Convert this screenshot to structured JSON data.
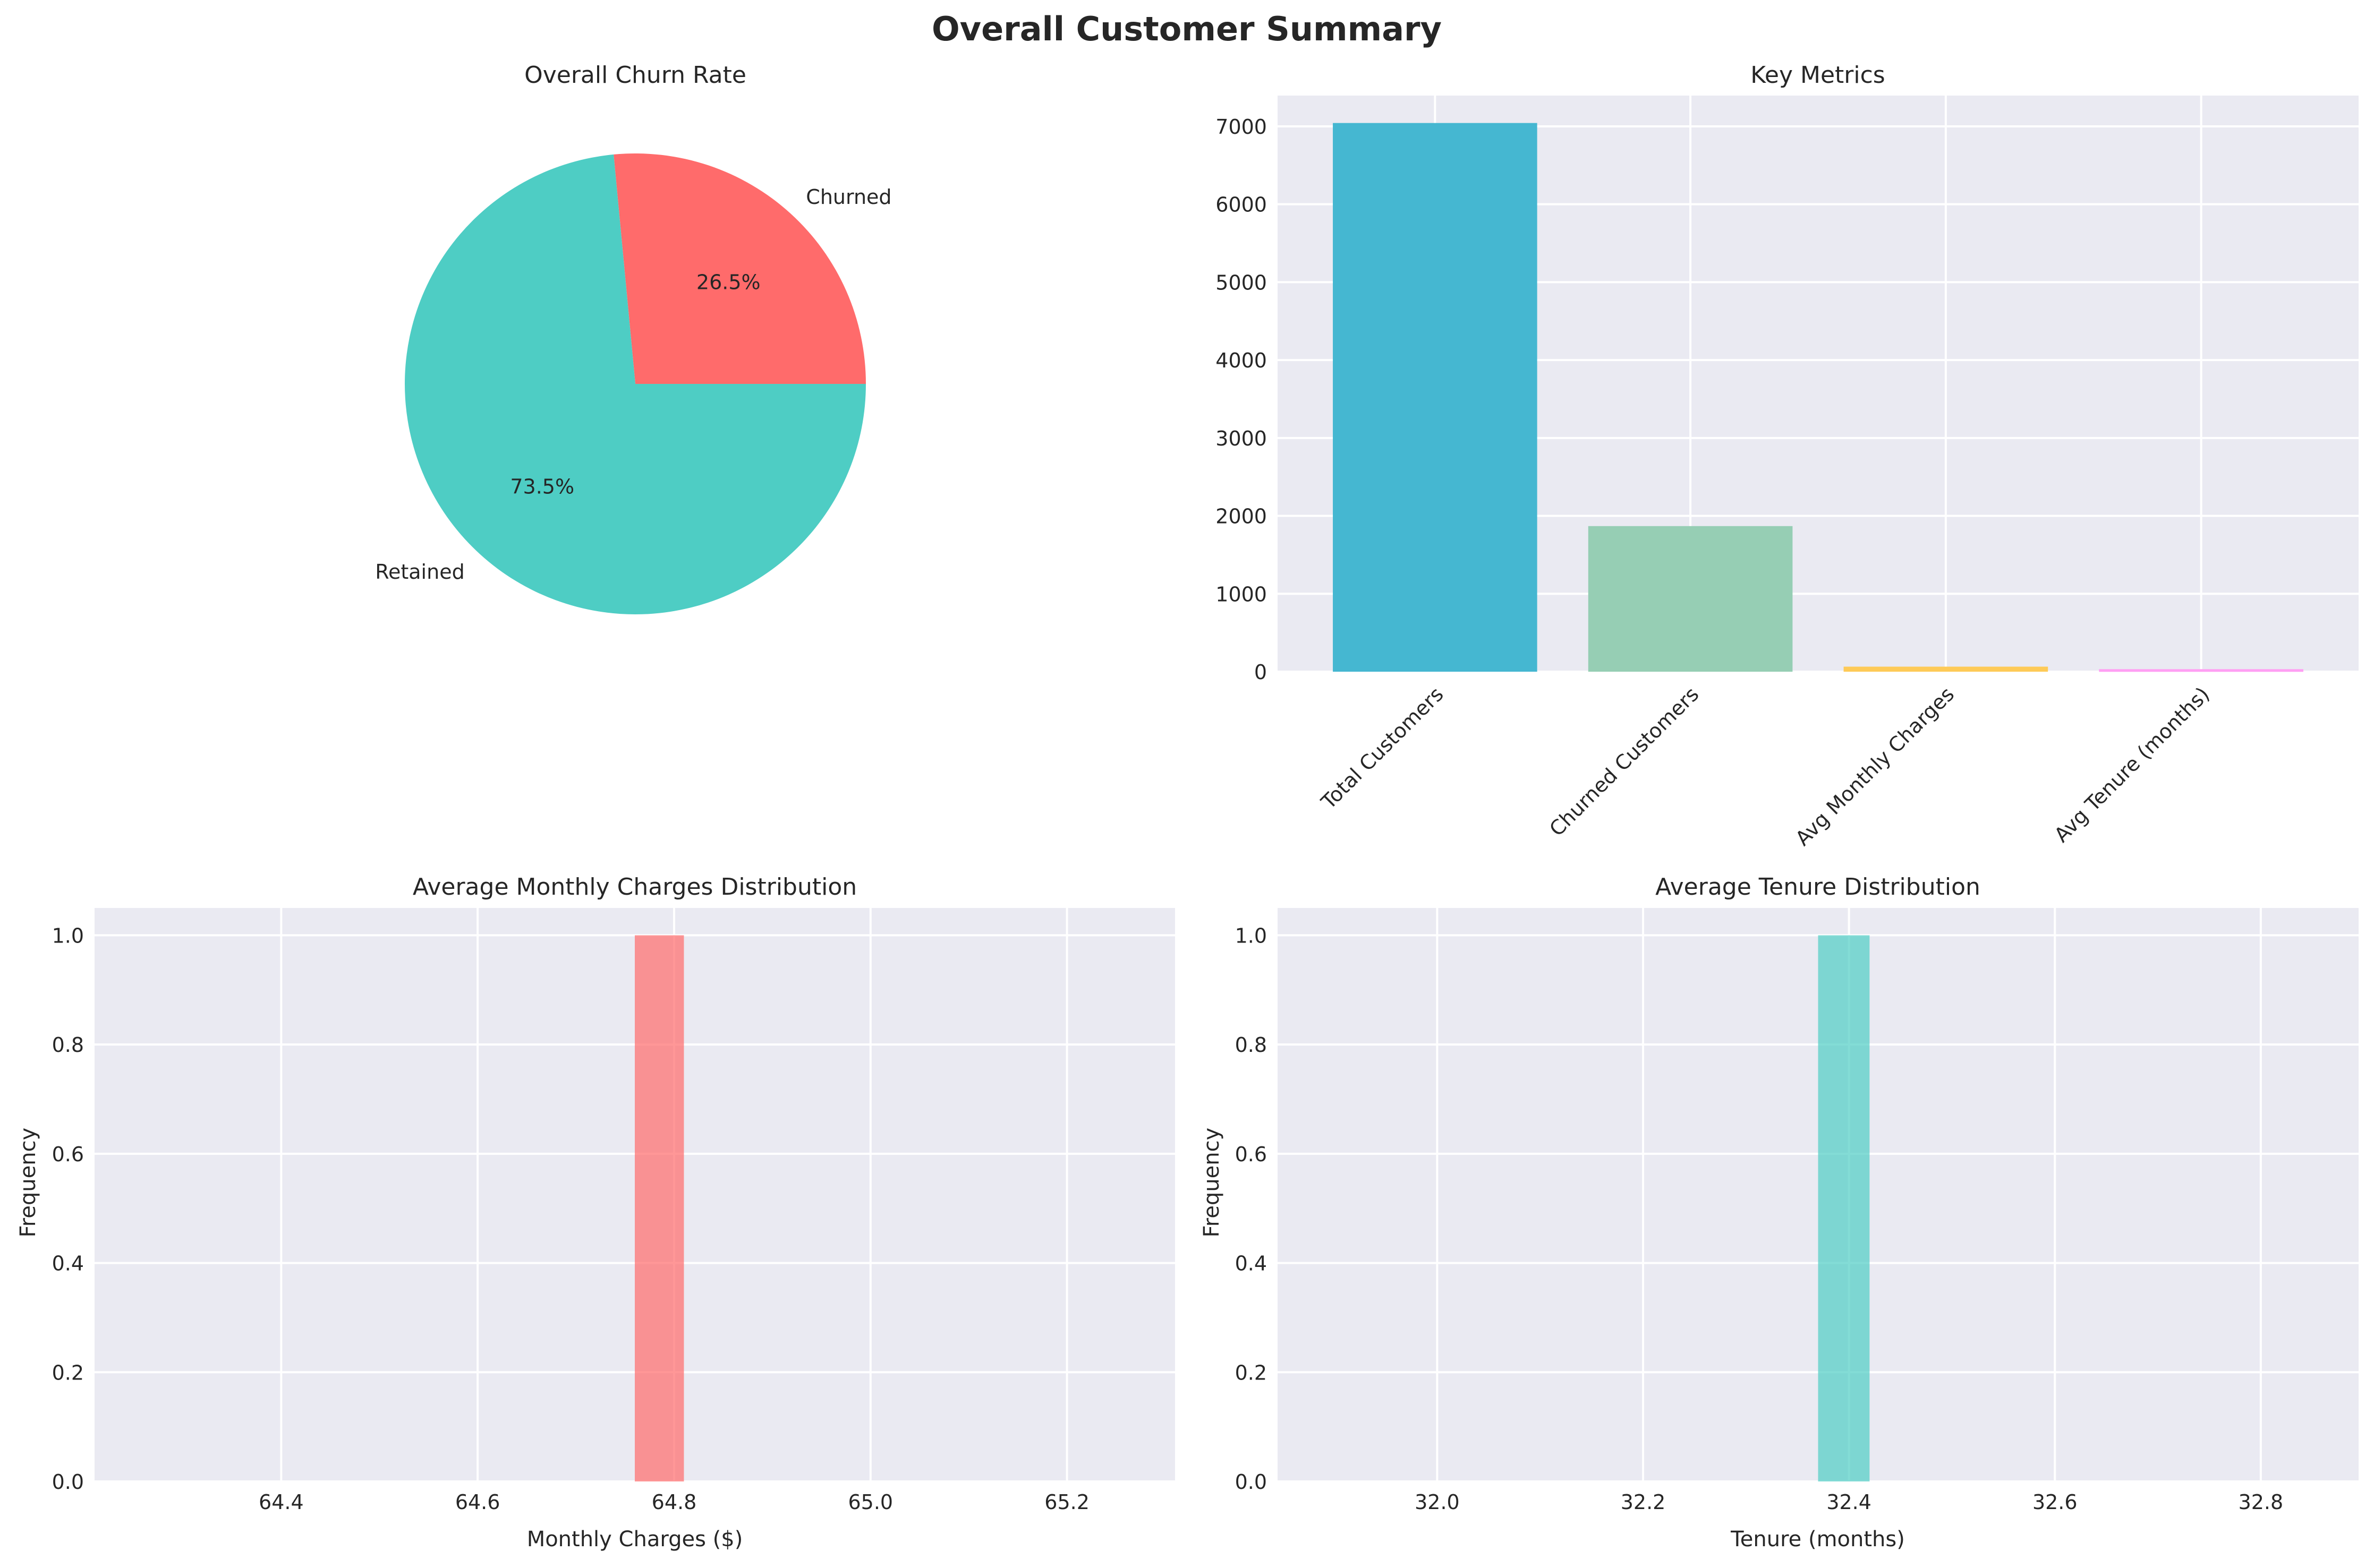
{
  "figure": {
    "title": "Overall Customer Summary"
  },
  "colors": {
    "background": "#eaeaf2",
    "grid": "#ffffff",
    "text": "#262626",
    "churned": "#ff6b6b",
    "retained": "#4ecdc4",
    "bar_total": "#45b7d1",
    "bar_churned": "#96ceb4",
    "bar_charges": "#feca57",
    "bar_tenure": "#ff9ff3"
  },
  "chart_data": [
    {
      "type": "pie",
      "title": "Overall Churn Rate",
      "labels": [
        "Churned",
        "Retained"
      ],
      "values": [
        26.5,
        73.5
      ],
      "autopct": [
        "26.5%",
        "73.5%"
      ],
      "colors": [
        "#ff6b6b",
        "#4ecdc4"
      ],
      "startangle": 0
    },
    {
      "type": "bar",
      "title": "Key Metrics",
      "categories": [
        "Total Customers",
        "Churned Customers",
        "Avg Monthly Charges",
        "Avg Tenure (months)"
      ],
      "values": [
        7043,
        1869,
        64.76,
        32.37
      ],
      "colors": [
        "#45b7d1",
        "#96ceb4",
        "#feca57",
        "#ff9ff3"
      ],
      "ylim": [
        0,
        7395
      ],
      "yticks": [
        0,
        1000,
        2000,
        3000,
        4000,
        5000,
        6000,
        7000
      ],
      "grid": true
    },
    {
      "type": "bar",
      "title": "Average Monthly Charges Distribution",
      "xlabel": "Monthly Charges ($)",
      "ylabel": "Frequency",
      "bins": [
        {
          "x0": 64.76,
          "x1": 64.81,
          "count": 1
        }
      ],
      "xlim": [
        64.21,
        65.31
      ],
      "xticks": [
        64.4,
        64.6,
        64.8,
        65.0,
        65.2
      ],
      "ylim": [
        0,
        1.05
      ],
      "yticks": [
        0.0,
        0.2,
        0.4,
        0.6,
        0.8,
        1.0
      ],
      "color": "#ff6b6b",
      "grid": true
    },
    {
      "type": "bar",
      "title": "Average Tenure Distribution",
      "xlabel": "Tenure (months)",
      "ylabel": "Frequency",
      "bins": [
        {
          "x0": 32.37,
          "x1": 32.42,
          "count": 1
        }
      ],
      "xlim": [
        31.845,
        32.895
      ],
      "xticks": [
        32.0,
        32.2,
        32.4,
        32.6,
        32.8
      ],
      "ylim": [
        0,
        1.05
      ],
      "yticks": [
        0.0,
        0.2,
        0.4,
        0.6,
        0.8,
        1.0
      ],
      "color": "#4ecdc4",
      "grid": true
    }
  ]
}
